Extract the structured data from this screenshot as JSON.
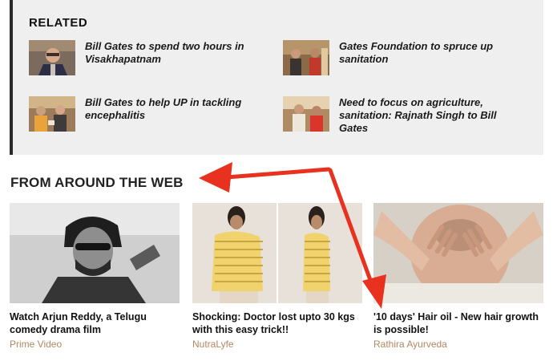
{
  "related": {
    "heading": "RELATED",
    "items": [
      {
        "title": "Bill Gates to spend two hours in Visakhapatnam"
      },
      {
        "title": "Gates Foundation to spruce up sanitation"
      },
      {
        "title": "Bill Gates to help UP in tackling encephalitis"
      },
      {
        "title": "Need to focus on agriculture, sanitation: Rajnath Singh to Bill Gates"
      }
    ]
  },
  "web": {
    "heading": "FROM AROUND THE WEB",
    "cards": [
      {
        "title": "Watch Arjun Reddy, a Telugu comedy drama film",
        "source": "Prime Video"
      },
      {
        "title": "Shocking: Doctor lost upto 30 kgs with this easy trick!!",
        "source": "NutraLyfe"
      },
      {
        "title": "'10 days' Hair oil - New hair growth is possible!",
        "source": "Rathira Ayurveda"
      }
    ]
  },
  "colors": {
    "annotation_arrow": "#e8321f",
    "source_text": "#b48862",
    "related_bg": "#efefef"
  }
}
